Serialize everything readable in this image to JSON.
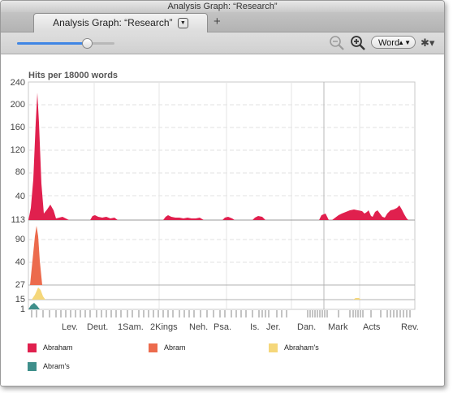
{
  "window": {
    "title": "Analysis Graph: “Research”"
  },
  "tab": {
    "label": "Analysis Graph: “Research”",
    "menu_glyph": "▼",
    "add_glyph": "+"
  },
  "toolbar": {
    "zoom_out_icon": "zoom-out-icon",
    "zoom_in_icon": "zoom-in-icon",
    "unit_select": "Word",
    "slider_value": 0.72,
    "gear_glyph": "✱▾"
  },
  "graph": {
    "title": "Hits per 18000 words",
    "top_panel": {
      "ymax": 240,
      "ymin": 0,
      "ticks": [
        "240",
        "200",
        "160",
        "120",
        "80",
        "40",
        "113"
      ]
    },
    "bottom_panel": {
      "ticks": [
        "90",
        "40",
        "27",
        "15",
        "1"
      ]
    },
    "x_labels": [
      "Lev.",
      "Deut.",
      "1Sam.",
      "2Kings",
      "Neh.",
      "Psa.",
      "Is.",
      "Jer.",
      "Dan.",
      "Mark",
      "Acts",
      "Rev."
    ]
  },
  "colors": {
    "abraham": "#e0204e",
    "abram": "#ec6b4d",
    "abrahams": "#f5d77a",
    "abrams": "#3f8f8b"
  },
  "legend": [
    {
      "label": "Abraham",
      "color": "#e0204e"
    },
    {
      "label": "Abram",
      "color": "#ec6b4d"
    },
    {
      "label": "Abraham's",
      "color": "#f5d77a"
    },
    {
      "label": "Abram's",
      "color": "#3f8f8b"
    }
  ]
}
